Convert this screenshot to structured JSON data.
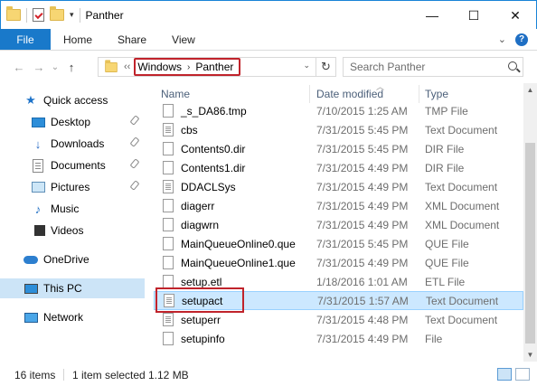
{
  "window": {
    "title": "Panther",
    "controls": {
      "minimize": "—",
      "maximize": "☐",
      "close": "✕"
    }
  },
  "ribbon": {
    "file_tab": "File",
    "tabs": [
      "Home",
      "Share",
      "View"
    ],
    "help": "?"
  },
  "navigation": {
    "back": "←",
    "forward": "→",
    "recent": "⌄",
    "up": "↑",
    "breadcrumb_prefix": "‹‹",
    "breadcrumbs": [
      "Windows",
      "Panther"
    ],
    "refresh": "↻",
    "search_placeholder": "Search Panther"
  },
  "sidebar": {
    "items": [
      {
        "label": "Quick access",
        "icon": "star-icon",
        "pinned": false,
        "selected": false
      },
      {
        "label": "Desktop",
        "icon": "desktop-icon",
        "pinned": true,
        "selected": false
      },
      {
        "label": "Downloads",
        "icon": "download-icon",
        "pinned": true,
        "selected": false
      },
      {
        "label": "Documents",
        "icon": "documents-icon",
        "pinned": true,
        "selected": false
      },
      {
        "label": "Pictures",
        "icon": "pictures-icon",
        "pinned": true,
        "selected": false
      },
      {
        "label": "Music",
        "icon": "music-icon",
        "pinned": false,
        "selected": false
      },
      {
        "label": "Videos",
        "icon": "videos-icon",
        "pinned": false,
        "selected": false
      },
      {
        "label": "OneDrive",
        "icon": "onedrive-icon",
        "pinned": false,
        "selected": false
      },
      {
        "label": "This PC",
        "icon": "this-pc-icon",
        "pinned": false,
        "selected": true
      },
      {
        "label": "Network",
        "icon": "network-icon",
        "pinned": false,
        "selected": false
      }
    ]
  },
  "file_list": {
    "columns": [
      "Name",
      "Date modified",
      "Type"
    ],
    "rows": [
      {
        "name": "_s_DA86.tmp",
        "date": "7/10/2015 1:25 AM",
        "type": "TMP File",
        "selected": false
      },
      {
        "name": "cbs",
        "date": "7/31/2015 5:45 PM",
        "type": "Text Document",
        "selected": false
      },
      {
        "name": "Contents0.dir",
        "date": "7/31/2015 5:45 PM",
        "type": "DIR File",
        "selected": false
      },
      {
        "name": "Contents1.dir",
        "date": "7/31/2015 4:49 PM",
        "type": "DIR File",
        "selected": false
      },
      {
        "name": "DDACLSys",
        "date": "7/31/2015 4:49 PM",
        "type": "Text Document",
        "selected": false
      },
      {
        "name": "diagerr",
        "date": "7/31/2015 4:49 PM",
        "type": "XML Document",
        "selected": false
      },
      {
        "name": "diagwrn",
        "date": "7/31/2015 4:49 PM",
        "type": "XML Document",
        "selected": false
      },
      {
        "name": "MainQueueOnline0.que",
        "date": "7/31/2015 5:45 PM",
        "type": "QUE File",
        "selected": false
      },
      {
        "name": "MainQueueOnline1.que",
        "date": "7/31/2015 4:49 PM",
        "type": "QUE File",
        "selected": false
      },
      {
        "name": "setup.etl",
        "date": "1/18/2016 1:01 AM",
        "type": "ETL File",
        "selected": false
      },
      {
        "name": "setupact",
        "date": "7/31/2015 1:57 AM",
        "type": "Text Document",
        "selected": true
      },
      {
        "name": "setuperr",
        "date": "7/31/2015 4:48 PM",
        "type": "Text Document",
        "selected": false
      },
      {
        "name": "setupinfo",
        "date": "7/31/2015 4:49 PM",
        "type": "File",
        "selected": false
      }
    ]
  },
  "status": {
    "item_count": "16 items",
    "selection": "1 item selected",
    "size": "1.12 MB"
  },
  "colors": {
    "accent": "#1979ca",
    "selection_bg": "#cce8ff",
    "highlight_red": "#c0232b"
  }
}
